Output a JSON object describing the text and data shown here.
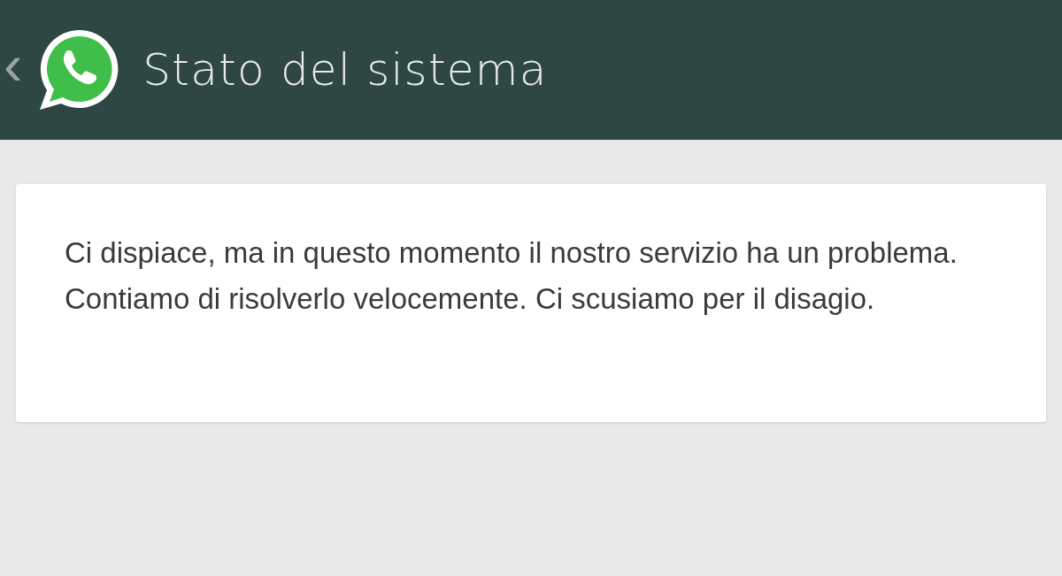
{
  "header": {
    "back": "‹",
    "title": "Stato del sistema"
  },
  "message": {
    "text": "Ci dispiace, ma in questo momento il nostro servizio ha un problema. Contiamo di risolverlo velocemente. Ci scusiamo per il disagio."
  }
}
